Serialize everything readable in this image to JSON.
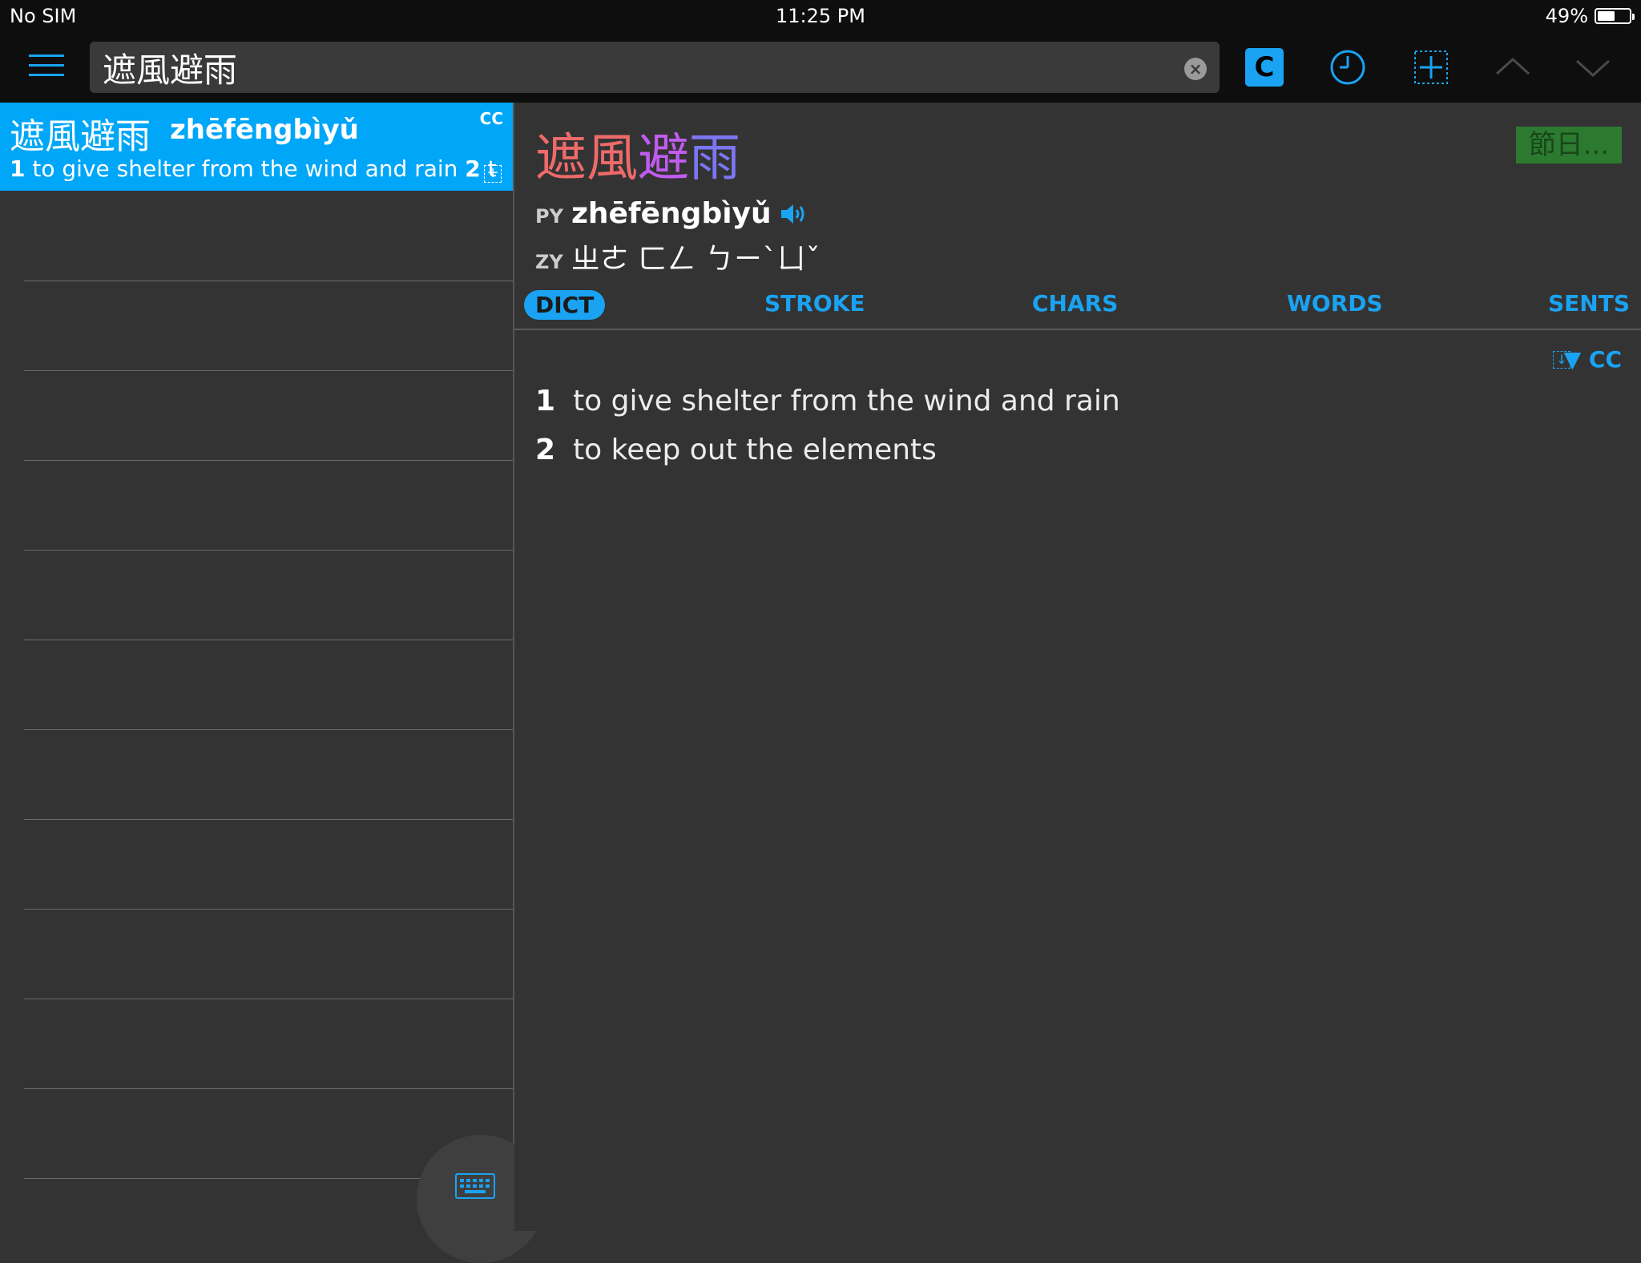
{
  "status": {
    "carrier": "No SIM",
    "time": "11:25 PM",
    "battery": "49%",
    "battery_level": 0.49
  },
  "toolbar": {
    "search_value": "遮風避雨",
    "c_label": "C",
    "icons": [
      "menu-icon",
      "clear-icon",
      "c-button",
      "history-clock-icon",
      "add-flashcard-icon",
      "chevron-up-icon",
      "chevron-down-icon"
    ]
  },
  "list": {
    "selected": {
      "hanzi": "遮風避雨",
      "pinyin": "zhēfēngbìyǔ",
      "source": "CC",
      "def_num1": "1",
      "def_text1": " to give shelter from the wind and rain ",
      "def_num2": "2",
      "def_text2": " t"
    }
  },
  "detail": {
    "headword": [
      "遮",
      "風",
      "避",
      "雨"
    ],
    "headword_colors": [
      "#f06a6a",
      "#f06a6a",
      "#c05cf0",
      "#7b76f2"
    ],
    "tag_label": "節日...",
    "py_label": "PY",
    "pinyin": "zhēfēngbìyǔ",
    "zy_label": "ZY",
    "zhuyin": "ㄓㄜ ㄈㄥ ㄅㄧˋㄩˇ",
    "tabs": [
      "DICT",
      "STROKE",
      "CHARS",
      "WORDS",
      "SENTS"
    ],
    "active_tab": "DICT",
    "source_toggle": "▼ CC",
    "definitions": [
      {
        "num": "1",
        "text": "to give shelter from the wind and rain"
      },
      {
        "num": "2",
        "text": "to keep out the elements"
      }
    ]
  },
  "colors": {
    "accent": "#1aa3f2",
    "selected_bg": "#00a6f7",
    "panel_bg": "#333333",
    "bar_bg": "#0e0e0e",
    "tag_bg": "#2c7a2f"
  }
}
